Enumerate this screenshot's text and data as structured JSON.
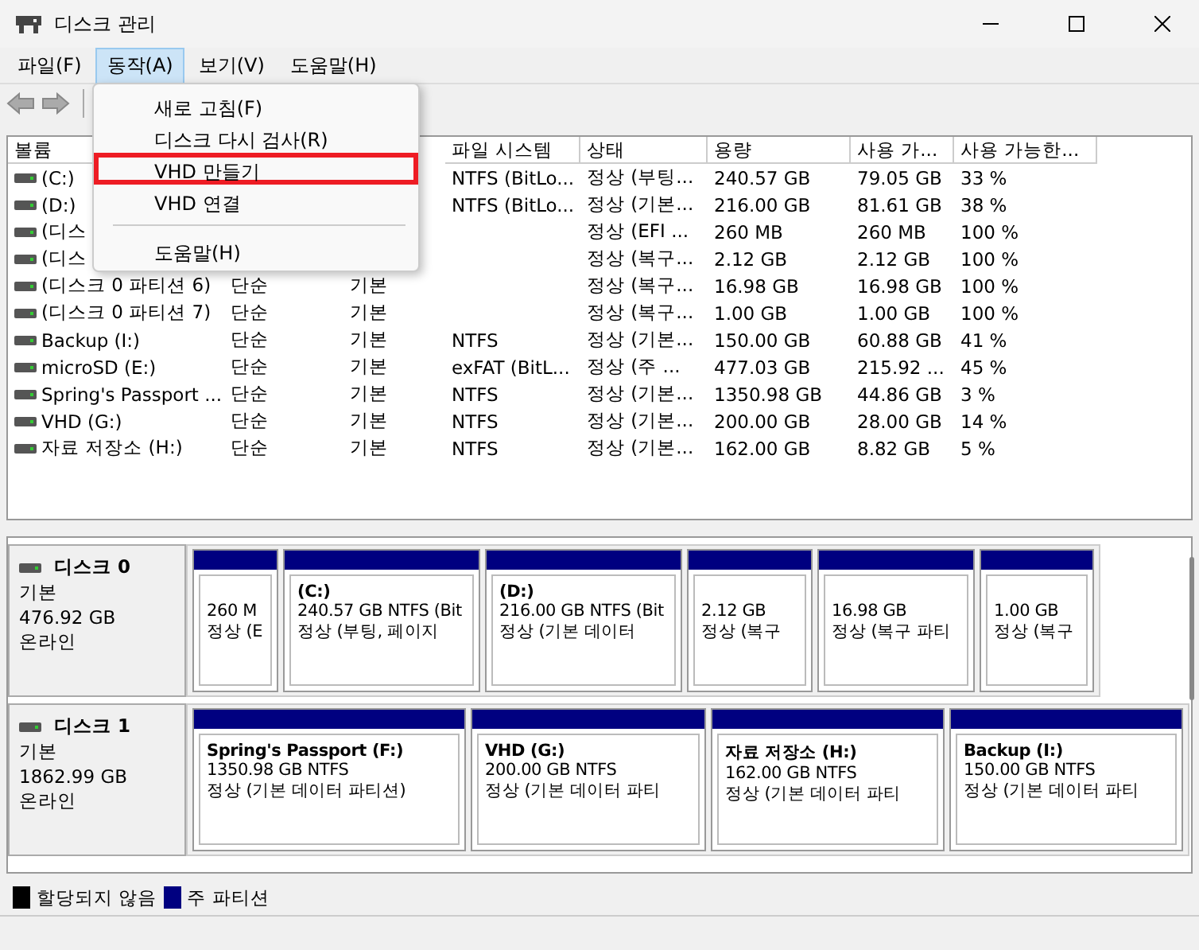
{
  "window": {
    "title": "디스크 관리"
  },
  "menubar": [
    {
      "label": "파일(F)",
      "selected": false
    },
    {
      "label": "동작(A)",
      "selected": true
    },
    {
      "label": "보기(V)",
      "selected": false
    },
    {
      "label": "도움말(H)",
      "selected": false
    }
  ],
  "action_menu": {
    "items": [
      {
        "kind": "item",
        "label": "새로 고침(F)",
        "highlighted": false
      },
      {
        "kind": "item",
        "label": "디스크 다시 검사(R)",
        "highlighted": false
      },
      {
        "kind": "item",
        "label": "VHD 만들기",
        "highlighted": true
      },
      {
        "kind": "item",
        "label": "VHD 연결",
        "highlighted": false
      },
      {
        "kind": "separator"
      },
      {
        "kind": "item",
        "label": "도움말(H)",
        "highlighted": false
      }
    ]
  },
  "table": {
    "columns": [
      "볼륨",
      "파일 시스템",
      "상태",
      "용량",
      "사용 가...",
      "사용 가능한..."
    ],
    "rows": [
      {
        "volume": "(C:)",
        "file_system": "NTFS (BitLo...",
        "status": "정상 (부팅...",
        "capacity": "240.57 GB",
        "free": "79.05 GB",
        "percent": "33 %"
      },
      {
        "volume": "(D:)",
        "file_system": "NTFS (BitLo...",
        "status": "정상 (기본...",
        "capacity": "216.00 GB",
        "free": "81.61 GB",
        "percent": "38 %"
      },
      {
        "volume": "(디스",
        "status": "정상 (EFI ...",
        "capacity": "260 MB",
        "free": "260 MB",
        "percent": "100 %"
      },
      {
        "volume": "(디스",
        "status": "정상 (복구...",
        "capacity": "2.12 GB",
        "free": "2.12 GB",
        "percent": "100 %"
      },
      {
        "volume": "(디스크 0 파티션 6)",
        "layout": "단순",
        "type": "기본",
        "status": "정상 (복구...",
        "capacity": "16.98 GB",
        "free": "16.98 GB",
        "percent": "100 %"
      },
      {
        "volume": "(디스크 0 파티션 7)",
        "layout": "단순",
        "type": "기본",
        "status": "정상 (복구...",
        "capacity": "1.00 GB",
        "free": "1.00 GB",
        "percent": "100 %"
      },
      {
        "volume": "Backup (I:)",
        "layout": "단순",
        "type": "기본",
        "file_system": "NTFS",
        "status": "정상 (기본...",
        "capacity": "150.00 GB",
        "free": "60.88 GB",
        "percent": "41 %"
      },
      {
        "volume": "microSD (E:)",
        "layout": "단순",
        "type": "기본",
        "file_system": "exFAT (BitL...",
        "status": "정상 (주 ...",
        "capacity": "477.03 GB",
        "free": "215.92 ...",
        "percent": "45 %"
      },
      {
        "volume": "Spring's Passport ...",
        "layout": "단순",
        "type": "기본",
        "file_system": "NTFS",
        "status": "정상 (기본...",
        "capacity": "1350.98 GB",
        "free": "44.86 GB",
        "percent": "3 %"
      },
      {
        "volume": "VHD (G:)",
        "layout": "단순",
        "type": "기본",
        "file_system": "NTFS",
        "status": "정상 (기본...",
        "capacity": "200.00 GB",
        "free": "28.00 GB",
        "percent": "14 %"
      },
      {
        "volume": "자료 저장소 (H:)",
        "layout": "단순",
        "type": "기본",
        "file_system": "NTFS",
        "status": "정상 (기본...",
        "capacity": "162.00 GB",
        "free": "8.82 GB",
        "percent": "5 %"
      }
    ]
  },
  "disks": [
    {
      "name": "디스크 0",
      "type": "기본",
      "size": "476.92 GB",
      "state": "온라인",
      "partitions": [
        {
          "lines": [
            "260 M",
            "정상 (E"
          ]
        },
        {
          "title": "(C:)",
          "lines": [
            "240.57 GB NTFS (Bit",
            "정상 (부팅, 페이지"
          ]
        },
        {
          "title": "(D:)",
          "lines": [
            "216.00 GB NTFS (Bit",
            "정상 (기본 데이터"
          ]
        },
        {
          "lines": [
            "2.12 GB",
            "정상 (복구"
          ]
        },
        {
          "lines": [
            "16.98 GB",
            "정상 (복구 파티"
          ]
        },
        {
          "lines": [
            "1.00 GB",
            "정상 (복구"
          ]
        }
      ]
    },
    {
      "name": "디스크 1",
      "type": "기본",
      "size": "1862.99 GB",
      "state": "온라인",
      "partitions": [
        {
          "title": "Spring's Passport  (F:)",
          "lines": [
            "1350.98 GB NTFS",
            "정상 (기본 데이터 파티션)"
          ]
        },
        {
          "title": "VHD  (G:)",
          "lines": [
            "200.00 GB NTFS",
            "정상 (기본 데이터 파티"
          ]
        },
        {
          "title": "자료 저장소  (H:)",
          "lines": [
            "162.00 GB NTFS",
            "정상 (기본 데이터 파티"
          ]
        },
        {
          "title": "Backup  (I:)",
          "lines": [
            "150.00 GB NTFS",
            "정상 (기본 데이터 파티"
          ]
        }
      ]
    }
  ],
  "legend": [
    {
      "label": "할당되지 않음",
      "color": "#000000"
    },
    {
      "label": "주 파티션",
      "color": "#000080"
    }
  ]
}
